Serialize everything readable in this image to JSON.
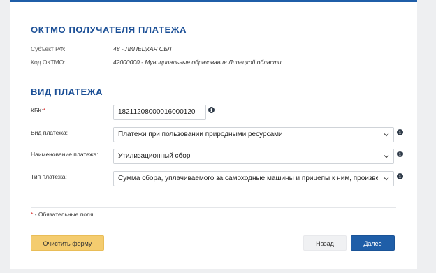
{
  "recipient_section": {
    "title": "ОКТМО ПОЛУЧАТЕЛЯ ПЛАТЕЖА",
    "subject_label": "Субъект РФ:",
    "subject_value": "48 - ЛИПЕЦКАЯ ОБЛ",
    "oktmo_label": "Код ОКТМО:",
    "oktmo_value": "42000000 - Муниципальные образования Липецкой области"
  },
  "payment_section": {
    "title": "ВИД ПЛАТЕЖА",
    "kbk_label": "КБК:",
    "required_mark": "*",
    "kbk_value": "18211208000016000120",
    "type_label": "Вид платежа:",
    "type_value": "Платежи при пользовании природными ресурсами",
    "name_label": "Наименование платежа:",
    "name_value": "Утилизационный сбор",
    "kind_label": "Тип платежа:",
    "kind_value": "Сумма сбора, уплачиваемого за самоходные машины и прицепы к ним, произведенные"
  },
  "icons": {
    "info": "i",
    "info_icon_name": "info-icon",
    "chevron_icon_name": "chevron-down-icon"
  },
  "footer": {
    "required_mark": "*",
    "required_note": " - Обязательные поля.",
    "clear_button": "Очистить форму",
    "back_button": "Назад",
    "next_button": "Далее"
  },
  "colors": {
    "accent": "#1f5ea8",
    "title": "#1b4f96",
    "required": "#d9302f",
    "clear_button": "#f4cc6f"
  }
}
